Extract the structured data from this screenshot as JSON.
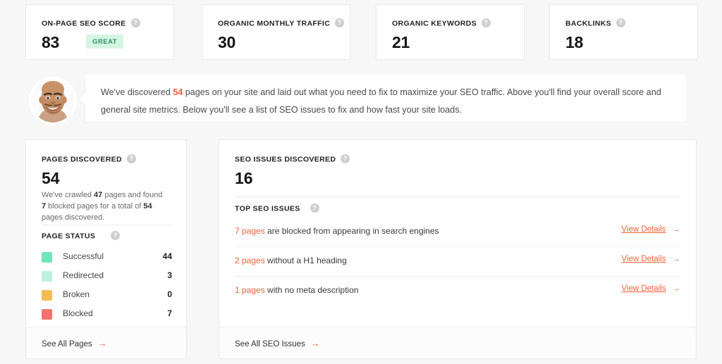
{
  "metrics": [
    {
      "label": "ON-PAGE SEO SCORE",
      "value": "83",
      "badge": "GREAT",
      "help": "help-icon"
    },
    {
      "label": "ORGANIC MONTHLY TRAFFIC",
      "value": "30",
      "help": "help-icon"
    },
    {
      "label": "ORGANIC KEYWORDS",
      "value": "21",
      "help": "help-icon"
    },
    {
      "label": "BACKLINKS",
      "value": "18",
      "help": "help-icon"
    }
  ],
  "banner": {
    "avatar_alt": "user-avatar-photo",
    "line1_a": "We've discovered ",
    "line1_count": "54",
    "line1_b": " pages on your site and laid out what you need to fix to maximize your SEO traffic. Above you'll find your overall score and general site metrics. Below you'll see a list of SEO issues to fix and how fast your site loads."
  },
  "pages_panel": {
    "title": "PAGES DISCOVERED",
    "value": "54",
    "crawl_a": "We've crawled ",
    "crawl_crawled": "47",
    "crawl_b": " pages and found ",
    "crawl_blocked": "7",
    "crawl_c": " blocked pages for a total of ",
    "crawl_total": "54",
    "crawl_d": " pages discovered.",
    "status_title": "PAGE STATUS",
    "statuses": [
      {
        "name": "Successful",
        "count": "44",
        "color": "#6ee7b7"
      },
      {
        "name": "Redirected",
        "count": "3",
        "color": "#bdf0da"
      },
      {
        "name": "Broken",
        "count": "0",
        "color": "#f7bb55"
      },
      {
        "name": "Blocked",
        "count": "7",
        "color": "#f7716f"
      }
    ],
    "footer_link": "See All Pages"
  },
  "issues_panel": {
    "title": "SEO ISSUES DISCOVERED",
    "value": "16",
    "section_title": "TOP SEO ISSUES",
    "issues": [
      {
        "count": "7 pages",
        "text": " are blocked from appearing in search engines",
        "action": "View Details"
      },
      {
        "count": "2 pages",
        "text": " without a H1 heading",
        "action": "View Details"
      },
      {
        "count": "1 pages",
        "text": " with no meta description",
        "action": "View Details"
      }
    ],
    "footer_link": "See All SEO Issues"
  },
  "colors": {
    "accent": "#f4613c",
    "page_bg": "#f7f7f7",
    "card_bg": "#ffffff",
    "badge_bg": "#d5f5e3",
    "badge_text": "#2f8f6b"
  }
}
